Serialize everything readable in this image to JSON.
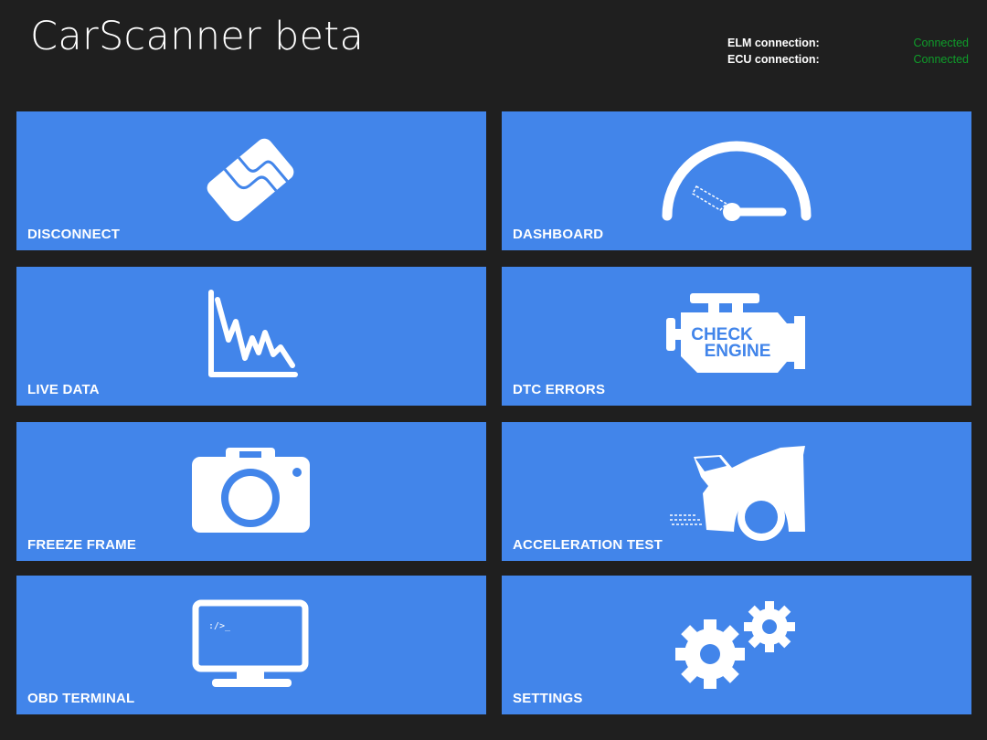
{
  "app": {
    "title": "CarScanner beta"
  },
  "status": {
    "elm_label": "ELM connection:",
    "elm_value": "Connected",
    "ecu_label": "ECU connection:",
    "ecu_value": "Connected"
  },
  "colors": {
    "background": "#1f1f1f",
    "tile": "#4285ea",
    "connected": "#0f9d2a"
  },
  "tiles": [
    {
      "label": "DISCONNECT",
      "icon": "plug-connector-icon"
    },
    {
      "label": "DASHBOARD",
      "icon": "speedometer-icon"
    },
    {
      "label": "LIVE DATA",
      "icon": "line-chart-icon"
    },
    {
      "label": "DTC ERRORS",
      "icon": "check-engine-icon"
    },
    {
      "label": "FREEZE FRAME",
      "icon": "camera-icon"
    },
    {
      "label": "ACCELERATION TEST",
      "icon": "accelerating-car-icon"
    },
    {
      "label": "OBD TERMINAL",
      "icon": "terminal-monitor-icon"
    },
    {
      "label": "SETTINGS",
      "icon": "gears-icon"
    }
  ],
  "icon_text": {
    "check_engine_line1": "CHECK",
    "check_engine_line2": "ENGINE",
    "terminal_prompt": ":/>_"
  }
}
